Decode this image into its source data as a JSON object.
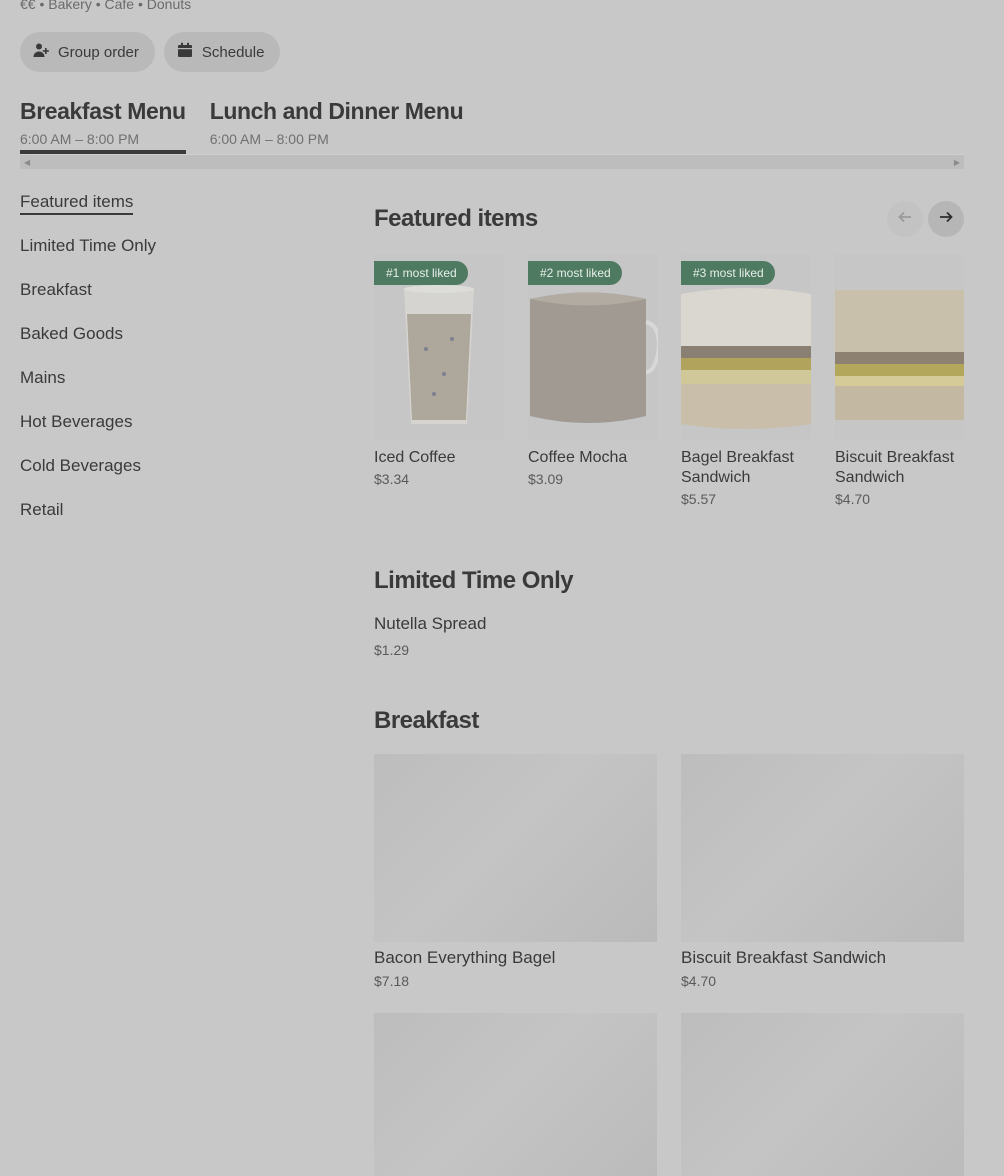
{
  "store": {
    "meta": "€€ • Bakery • Cafe • Donuts"
  },
  "actions": {
    "group_order": "Group order",
    "schedule": "Schedule"
  },
  "menus": [
    {
      "title": "Breakfast Menu",
      "hours": "6:00 AM – 8:00 PM",
      "active": true
    },
    {
      "title": "Lunch and Dinner Menu",
      "hours": "6:00 AM – 8:00 PM",
      "active": false
    }
  ],
  "nav": {
    "items": [
      {
        "label": "Featured items",
        "active": true
      },
      {
        "label": "Limited Time Only"
      },
      {
        "label": "Breakfast"
      },
      {
        "label": "Baked Goods"
      },
      {
        "label": "Mains"
      },
      {
        "label": "Hot Beverages"
      },
      {
        "label": "Cold Beverages"
      },
      {
        "label": "Retail"
      }
    ]
  },
  "featured": {
    "title": "Featured items",
    "items": [
      {
        "badge": "#1 most liked",
        "name": "Iced Coffee",
        "price": "$3.34"
      },
      {
        "badge": "#2 most liked",
        "name": "Coffee Mocha",
        "price": "$3.09"
      },
      {
        "badge": "#3 most liked",
        "name": "Bagel Breakfast Sandwich",
        "price": "$5.57"
      },
      {
        "name": "Biscuit Breakfast Sandwich",
        "price": "$4.70"
      }
    ]
  },
  "limited": {
    "title": "Limited Time Only",
    "items": [
      {
        "name": "Nutella Spread",
        "price": "$1.29"
      }
    ]
  },
  "breakfast": {
    "title": "Breakfast",
    "items": [
      {
        "name": "Bacon Everything Bagel",
        "price": "$7.18"
      },
      {
        "name": "Biscuit Breakfast Sandwich",
        "price": "$4.70"
      }
    ]
  },
  "colors": {
    "badge": "#4e7a62",
    "overlay": "#c8c8c8",
    "text": "#3a3a3a"
  },
  "icons": {
    "group_order": "add-person-icon",
    "schedule": "calendar-icon",
    "prev": "arrow-left-icon",
    "next": "arrow-right-icon"
  }
}
